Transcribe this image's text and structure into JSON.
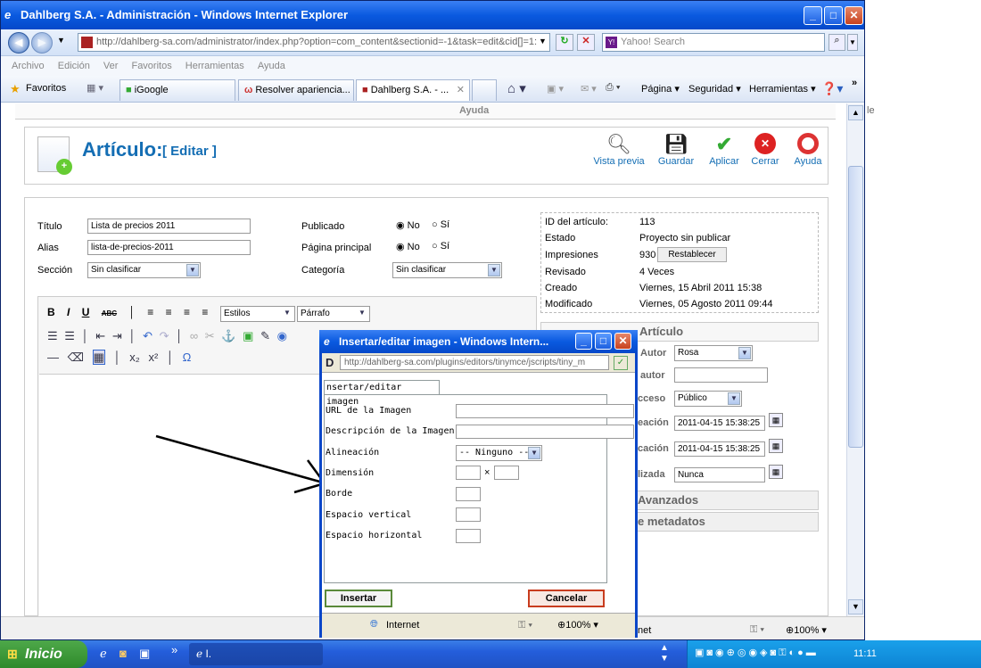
{
  "window": {
    "title": "Dahlberg S.A. - Administración - Windows Internet Explorer"
  },
  "address": {
    "url": "http://dahlberg-sa.com/administrator/index.php?option=com_content&sectionid=-1&task=edit&cid[]=1:",
    "search_placeholder": "Yahoo! Search"
  },
  "menu": [
    "Archivo",
    "Edición",
    "Ver",
    "Favoritos",
    "Herramientas",
    "Ayuda"
  ],
  "favbar": {
    "favorites": "Favoritos",
    "tabs": [
      "iGoogle",
      "Resolver apariencia...",
      "Dahlberg S.A. - ..."
    ],
    "tools": [
      "Página",
      "Seguridad",
      "Herramientas"
    ]
  },
  "page": {
    "top_menu_help": "Ayuda",
    "heading": "Artículo:",
    "heading_sub": "[ Editar ]",
    "toolbar": [
      "Vista previa",
      "Guardar",
      "Aplicar",
      "Cerrar",
      "Ayuda"
    ],
    "form": {
      "title_label": "Título",
      "title_value": "Lista de precios 2011",
      "alias_label": "Alias",
      "alias_value": "lista-de-precios-2011",
      "section_label": "Sección",
      "section_value": "Sin clasificar",
      "published_label": "Publicado",
      "frontpage_label": "Página principal",
      "category_label": "Categoría",
      "category_value": "Sin clasificar",
      "no": "No",
      "si": "Sí"
    },
    "info": {
      "id_label": "ID del artículo:",
      "id_value": "113",
      "state_label": "Estado",
      "state_value": "Proyecto sin publicar",
      "hits_label": "Impresiones",
      "hits_value": "930",
      "reset_btn": "Restablecer",
      "revised_label": "Revisado",
      "revised_value": "4 Veces",
      "created_label": "Creado",
      "created_value": "Viernes, 15 Abril 2011 15:38",
      "modified_label": "Modificado",
      "modified_value": "Viernes, 05 Agosto 2011 09:44"
    },
    "params": {
      "header": "Artículo",
      "author_label": "Autor",
      "author_value": "Rosa",
      "alias_author_label": "autor",
      "access_label": "cceso",
      "access_value": "Público",
      "created_label": "eación",
      "created_value": "2011-04-15 15:38:25",
      "start_label": "cación",
      "start_value": "2011-04-15 15:38:25",
      "finish_label": "lizada",
      "finish_value": "Nunca",
      "advanced": "Avanzados",
      "metadata": "e metadatos"
    },
    "editor": {
      "styles": "Estilos",
      "format": "Párrafo"
    }
  },
  "dialog": {
    "title": "Insertar/editar imagen - Windows Intern...",
    "url": "http://dahlberg-sa.com/plugins/editors/tinymce/jscripts/tiny_m",
    "tab": "nsertar/editar imagen",
    "fields": [
      "URL de la Imagen",
      "Descripción de la Imagen",
      "Alineación",
      "Dimensión",
      "Borde",
      "Espacio vertical",
      "Espacio horizontal"
    ],
    "align_value": "-- Ninguno --",
    "insert": "Insertar",
    "cancel": "Cancelar",
    "status_zone": "Internet",
    "zoom": "100%"
  },
  "status": {
    "zone": "net",
    "zoom": "100%"
  },
  "taskbar": {
    "start": "Inicio",
    "task": "I.",
    "clock": "11:11"
  },
  "colors": {
    "title_blue": "#0a5ae0",
    "taskbar_blue": "#245edb",
    "start_green": "#3a9b35",
    "cancel_red": "#c83c1e"
  }
}
